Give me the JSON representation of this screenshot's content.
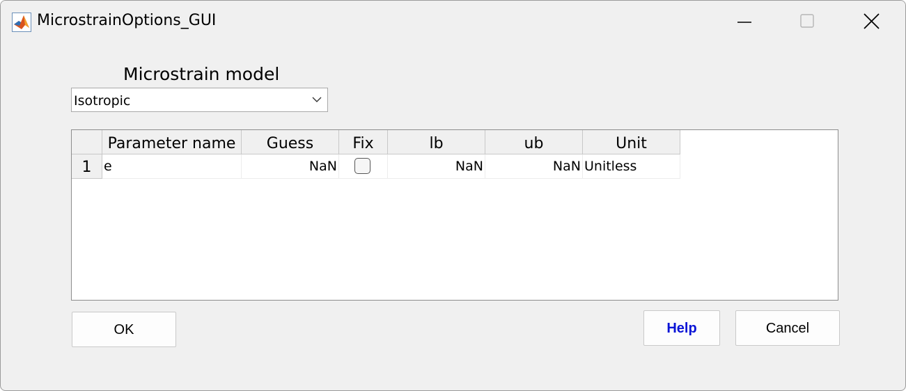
{
  "window": {
    "title": "MicrostrainOptions_GUI",
    "app_icon": "matlab-icon",
    "controls": [
      "minimize-icon",
      "maximize-icon",
      "close-icon"
    ]
  },
  "model": {
    "label": "Microstrain model",
    "selected": "Isotropic"
  },
  "table": {
    "columns": [
      "Parameter name",
      "Guess",
      "Fix",
      "lb",
      "ub",
      "Unit"
    ],
    "rows": [
      {
        "index": "1",
        "name": "e",
        "guess": "NaN",
        "fix": false,
        "lb": "NaN",
        "ub": "NaN",
        "unit": "Unitless"
      }
    ]
  },
  "buttons": {
    "ok": "OK",
    "help": "Help",
    "cancel": "Cancel"
  },
  "colors": {
    "background": "#f0f0f0",
    "help_text": "#0a14d6"
  }
}
